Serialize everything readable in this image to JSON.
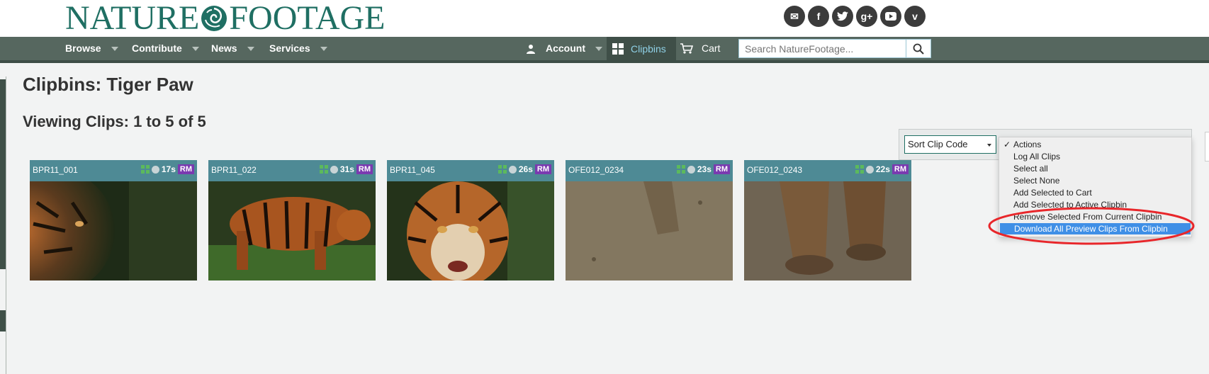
{
  "header": {
    "logo_left": "NATURE",
    "logo_right": "FOOTAGE",
    "social_icons": [
      "email-icon",
      "facebook-icon",
      "twitter-icon",
      "google-plus-icon",
      "youtube-icon",
      "vimeo-icon"
    ]
  },
  "nav": {
    "browse": "Browse",
    "contribute": "Contribute",
    "news": "News",
    "services": "Services",
    "account": "Account",
    "clipbins": "Clipbins",
    "cart": "Cart",
    "search_placeholder": "Search NatureFootage..."
  },
  "main": {
    "title": "Clipbins: Tiger Paw",
    "viewing": "Viewing Clips: 1 to 5 of 5",
    "clips": [
      {
        "code": "BPR11_001",
        "duration": "17s",
        "badge": "RM"
      },
      {
        "code": "BPR11_022",
        "duration": "31s",
        "badge": "RM"
      },
      {
        "code": "BPR11_045",
        "duration": "26s",
        "badge": "RM"
      },
      {
        "code": "OFE012_0234",
        "duration": "23s",
        "badge": "RM"
      },
      {
        "code": "OFE012_0243",
        "duration": "22s",
        "badge": "RM"
      }
    ]
  },
  "controls": {
    "sort_value": "Sort Clip Code",
    "actions_menu": [
      {
        "label": "Actions",
        "checked": true
      },
      {
        "label": "Log All Clips"
      },
      {
        "label": "Select all"
      },
      {
        "label": "Select None"
      },
      {
        "label": "Add Selected to Cart"
      },
      {
        "label": "Add Selected to Active Clipbin"
      },
      {
        "label": "Remove Selected From Current Clipbin"
      },
      {
        "label": "Download All Preview Clips From Clipbin",
        "highlighted": true
      }
    ]
  },
  "colors": {
    "brand": "#1f6f63",
    "nav_bg": "#56675f",
    "clip_header": "#4e8a95",
    "badge": "#7a3ab0",
    "highlight": "#3f8fe6",
    "annotation": "#e8262a"
  }
}
